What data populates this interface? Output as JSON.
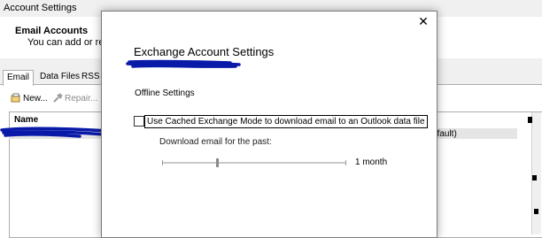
{
  "window": {
    "title": "Account Settings",
    "header_title": "Email Accounts",
    "header_subtitle": "You can add or remov",
    "tabs": [
      {
        "label": "Email"
      },
      {
        "label": "Data Files"
      },
      {
        "label": "RSS F"
      }
    ],
    "toolbar": {
      "new_label": "New...",
      "repair_label": "Repair..."
    },
    "list": {
      "column_name": "Name",
      "row_partial_text": "efault)"
    }
  },
  "dialog": {
    "title": "Exchange Account Settings",
    "section_label": "Offline Settings",
    "cached_mode": {
      "label": "Use Cached Exchange Mode to download email to an Outlook data file",
      "checked": false
    },
    "download_label": "Download email for the past:",
    "slider_value": "1 month",
    "close_icon": "close-icon"
  }
}
